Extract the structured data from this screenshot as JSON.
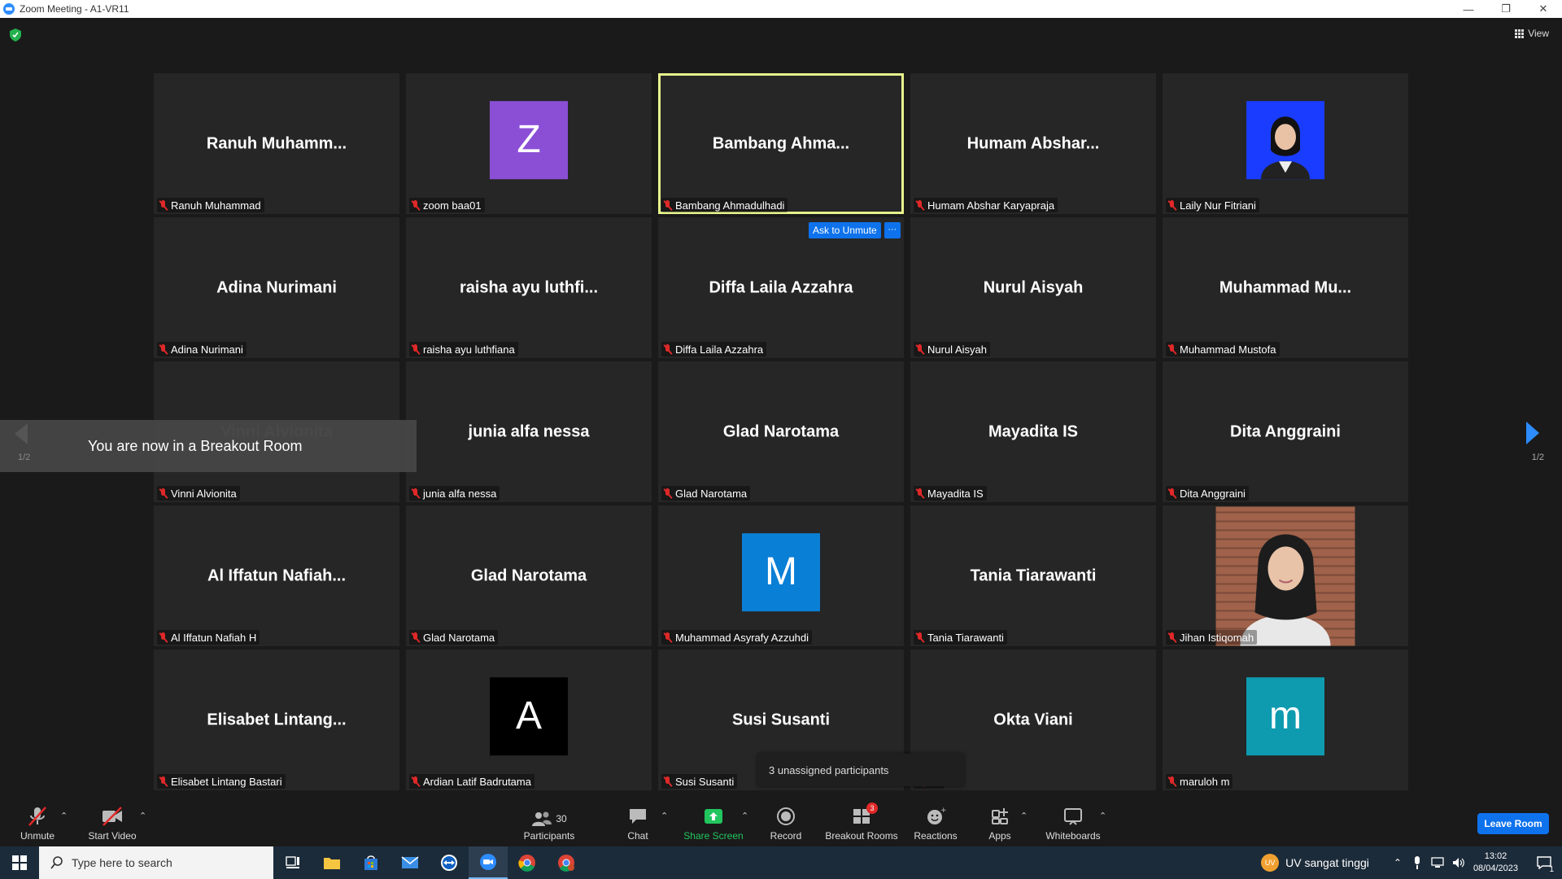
{
  "window": {
    "title": "Zoom Meeting - A1-VR11"
  },
  "view_label": "View",
  "tiles": [
    {
      "big": "Ranuh  Muhamm...",
      "tag": "Ranuh Muhammad"
    },
    {
      "big": "",
      "tag": "zoom baa01",
      "avatar": "Z",
      "avatar_color": "#8b4fd6"
    },
    {
      "big": "Bambang  Ahma...",
      "tag": "Bambang Ahmadulhadi",
      "active": true
    },
    {
      "big": "Humam  Abshar...",
      "tag": "Humam Abshar Karyapraja"
    },
    {
      "big": "",
      "tag": "Laily Nur Fitriani",
      "photo": "laily"
    },
    {
      "big": "Adina Nurimani",
      "tag": "Adina Nurimani"
    },
    {
      "big": "raisha  ayu  luthfi...",
      "tag": "raisha ayu luthfiana"
    },
    {
      "big": "Diffa Laila Azzahra",
      "tag": "Diffa Laila Azzahra"
    },
    {
      "big": "Nurul Aisyah",
      "tag": "Nurul Aisyah"
    },
    {
      "big": "Muhammad  Mu...",
      "tag": "Muhammad Mustofa"
    },
    {
      "big": "Vinni Alvionita",
      "tag": "Vinni Alvionita",
      "faded": true
    },
    {
      "big": "junia alfa nessa",
      "tag": "junia alfa nessa"
    },
    {
      "big": "Glad Narotama",
      "tag": "Glad Narotama"
    },
    {
      "big": "Mayadita IS",
      "tag": "Mayadita IS"
    },
    {
      "big": "Dita Anggraini",
      "tag": "Dita Anggraini"
    },
    {
      "big": "Al  Iffatun  Nafiah...",
      "tag": "Al Iffatun Nafiah H"
    },
    {
      "big": "Glad Narotama",
      "tag": "Glad Narotama"
    },
    {
      "big": "",
      "tag": "Muhammad Asyrafy Azzuhdi",
      "avatar": "M",
      "avatar_color": "#0a7fd6"
    },
    {
      "big": "Tania Tiarawanti",
      "tag": "Tania Tiarawanti"
    },
    {
      "big": "",
      "tag": "Jihan Istiqomah",
      "photo": "jihan"
    },
    {
      "big": "Elisabet  Lintang...",
      "tag": "Elisabet Lintang Bastari"
    },
    {
      "big": "",
      "tag": "Ardian Latif Badrutama",
      "avatar": "A",
      "avatar_color": "#000000"
    },
    {
      "big": "Susi Susanti",
      "tag": "Susi Susanti"
    },
    {
      "big": "Okta Viani",
      "tag": "ani"
    },
    {
      "big": "",
      "tag": "maruloh m",
      "avatar": "m",
      "avatar_color": "#0e9bb0"
    }
  ],
  "ask_to_unmute": "Ask to Unmute",
  "breakout_toast": "You are now in a Breakout Room",
  "page_indicator": "1/2",
  "unassigned_popup": "3 unassigned participants",
  "toolbar": {
    "unmute": "Unmute",
    "start_video": "Start Video",
    "participants": "Participants",
    "participants_count": "30",
    "chat": "Chat",
    "share_screen": "Share Screen",
    "record": "Record",
    "breakout_rooms": "Breakout Rooms",
    "breakout_badge": "3",
    "reactions": "Reactions",
    "apps": "Apps",
    "whiteboards": "Whiteboards",
    "leave": "Leave Room"
  },
  "taskbar": {
    "search_placeholder": "Type here to search",
    "weather": "UV sangat tinggi",
    "uv_badge": "UV",
    "time": "13:02",
    "date": "08/04/2023",
    "notif_count": "1"
  },
  "colors": {
    "accent": "#0e72ed",
    "share_green": "#22c55e",
    "muted_red": "#e02828",
    "active_border": "#e7f28c"
  }
}
